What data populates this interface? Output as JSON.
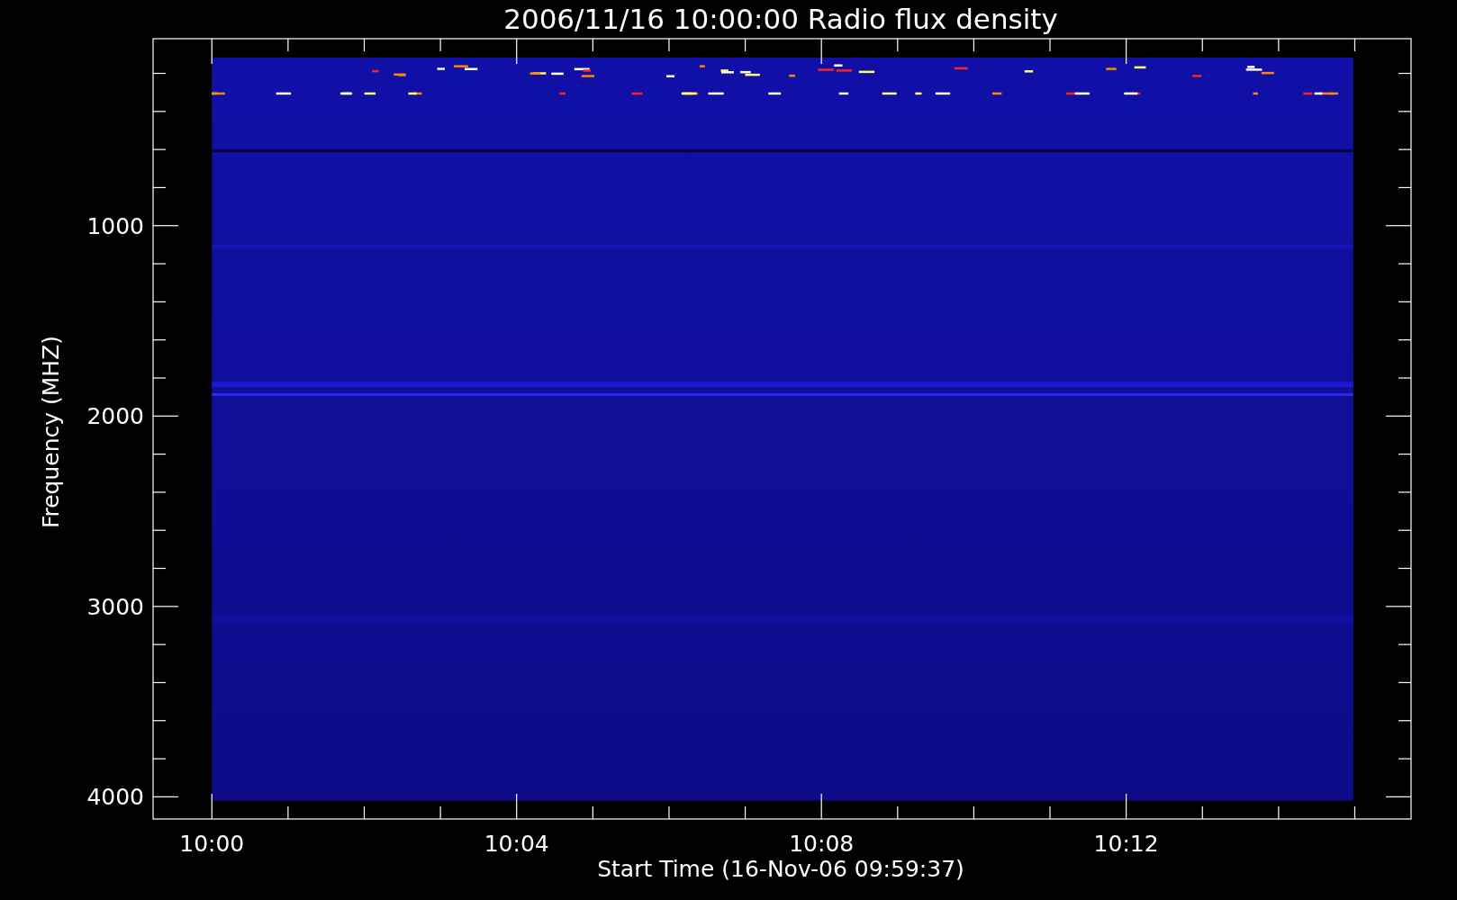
{
  "title": "2006/11/16 10:00:00 Radio flux density",
  "ylabel": "Frequency (MHZ)",
  "xlabel": "Start Time (16-Nov-06 09:59:37)",
  "yticks": [
    {
      "label": "1000"
    },
    {
      "label": "2000"
    },
    {
      "label": "3000"
    },
    {
      "label": "4000"
    }
  ],
  "xticks": [
    {
      "label": "10:00"
    },
    {
      "label": "10:04"
    },
    {
      "label": "10:08"
    },
    {
      "label": "10:12"
    }
  ]
}
